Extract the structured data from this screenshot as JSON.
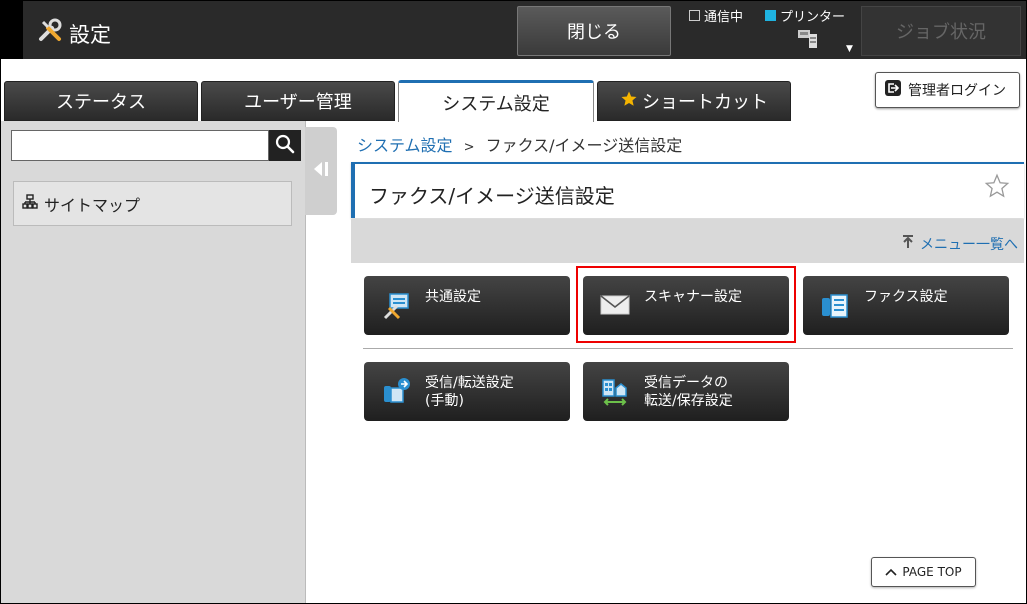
{
  "header": {
    "app_title": "設定",
    "close_label": "閉じる",
    "status_communicating": "通信中",
    "status_printer": "プリンター",
    "job_status_label": "ジョブ状況"
  },
  "tabs": [
    {
      "label": "ステータス"
    },
    {
      "label": "ユーザー管理"
    },
    {
      "label": "システム設定"
    },
    {
      "label": "ショートカット"
    }
  ],
  "admin_login_label": "管理者ログイン",
  "sidebar": {
    "search_placeholder": "",
    "sitemap_label": "サイトマップ"
  },
  "breadcrumb": {
    "parent": "システム設定",
    "separator": ">",
    "current": "ファクス/イメージ送信設定"
  },
  "page_title": "ファクス/イメージ送信設定",
  "menu_list_link": "メニュー一覧へ",
  "tiles": [
    {
      "label": "共通設定",
      "icon": "common-settings-icon"
    },
    {
      "label": "スキャナー設定",
      "icon": "envelope-icon"
    },
    {
      "label": "ファクス設定",
      "icon": "fax-icon"
    },
    {
      "label": "受信/転送設定\n(手動)",
      "icon": "receive-forward-icon"
    },
    {
      "label": "受信データの\n転送/保存設定",
      "icon": "data-transfer-icon"
    }
  ],
  "page_top_label": "PAGE TOP",
  "colors": {
    "accent": "#1f6fb2",
    "highlight": "#ee0000",
    "status_printer": "#1fb3e0",
    "star": "#f5b400"
  }
}
